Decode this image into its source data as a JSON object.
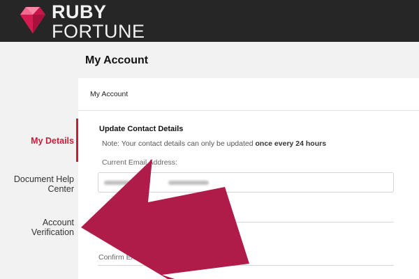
{
  "brand": {
    "line1": "RUBY",
    "line2": "FORTUNE",
    "accent": "#e8265a",
    "bar_color": "#262626"
  },
  "sidebar": {
    "items": [
      {
        "label": "My Details",
        "active": true
      },
      {
        "label": "Document Help Center"
      },
      {
        "label": "Account Verification"
      }
    ]
  },
  "page": {
    "title": "My Account",
    "breadcrumb": "My Account"
  },
  "form": {
    "section_title": "Update Contact Details",
    "note_prefix": "Note: Your contact details can only be updated ",
    "note_bold": "once every 24 hours",
    "current_email_label": "Current Email Address:",
    "confirm_label": "Confirm Email Address"
  },
  "overlay": {
    "arrow_color": "#b01c4a",
    "arrow_icon": "arrow-pointing-left"
  },
  "colors": {
    "active": "#c41f37"
  }
}
